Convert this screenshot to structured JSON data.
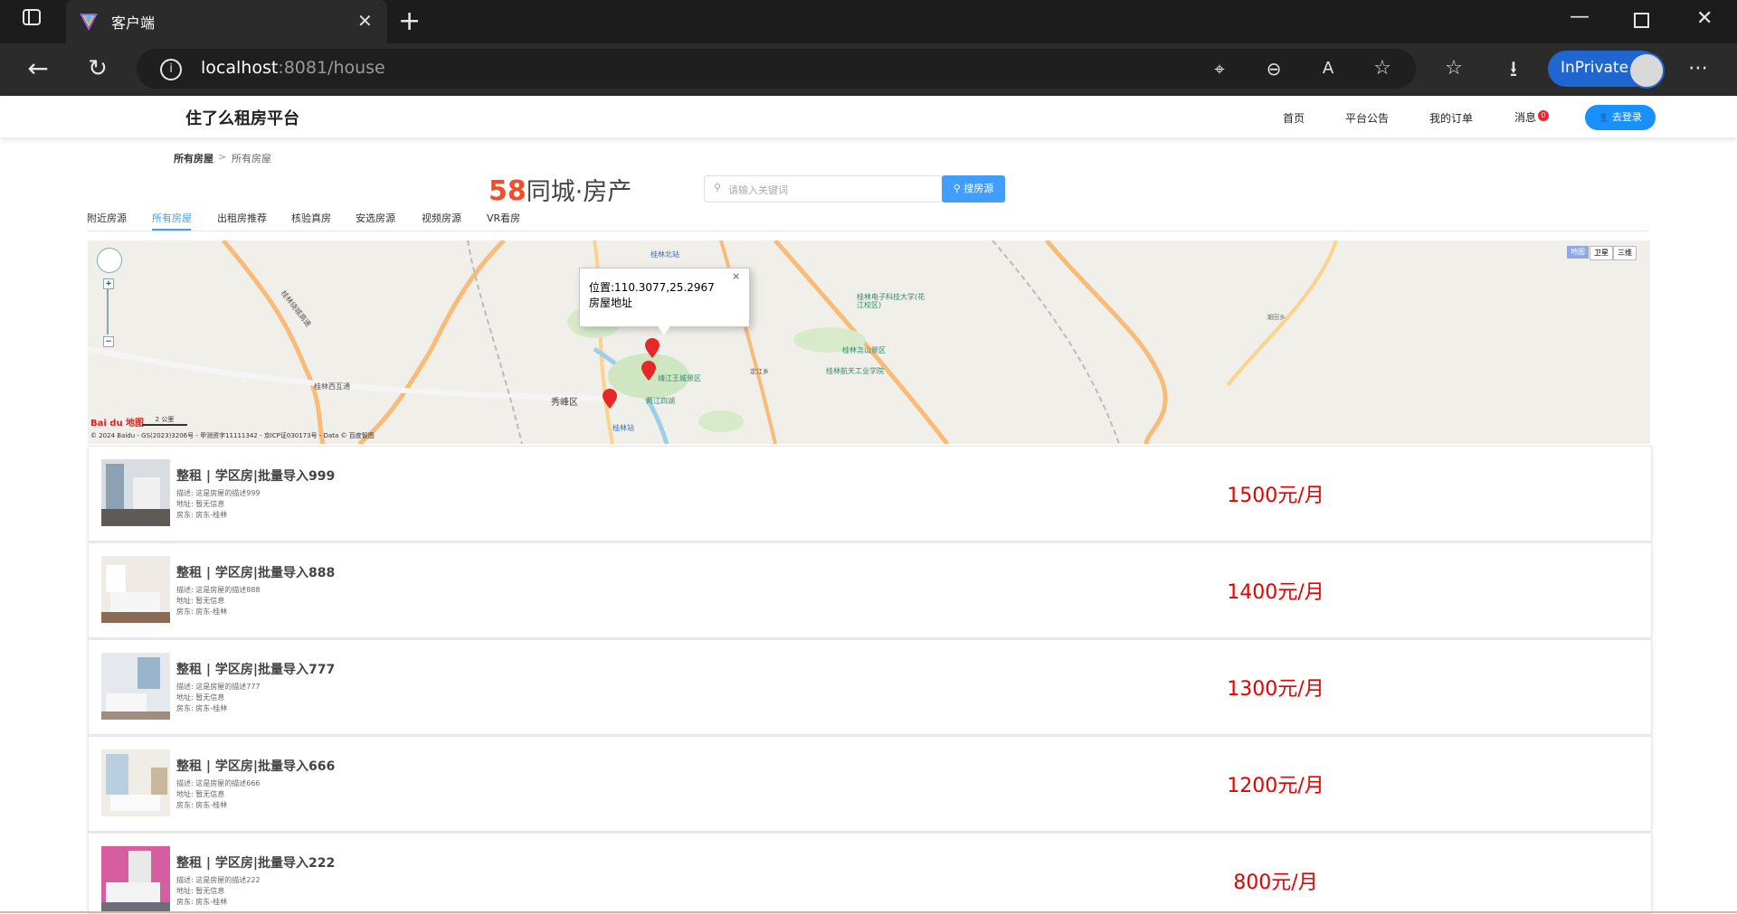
{
  "browser": {
    "tab_title": "客户端",
    "url_host": "localhost",
    "url_rest": ":8081/house",
    "inprivate_label": "InPrivate",
    "icons": [
      "tab-actions-icon",
      "edge-logo-icon",
      "close-tab-icon",
      "new-tab-icon",
      "minimize-icon",
      "restore-icon",
      "close-window-icon",
      "back-icon",
      "refresh-icon",
      "site-info-icon",
      "location-icon",
      "zoom-out-icon",
      "read-aloud-icon",
      "favorite-star-icon",
      "favorites-icon",
      "download-icon",
      "more-icon"
    ]
  },
  "header": {
    "site_title": "住了么租房平台",
    "nav": [
      "首页",
      "平台公告",
      "我的订单",
      "消息"
    ],
    "message_badge": "0",
    "login_label": "去登录"
  },
  "breadcrumb": {
    "home": "所有房屋",
    "separator": ">",
    "current": "所有房屋"
  },
  "brand": {
    "num": "58",
    "name": "同城·房产"
  },
  "search": {
    "placeholder": "请输入关键词",
    "button": "搜房源"
  },
  "tabs": [
    "附近房源",
    "所有房屋",
    "出租房推荐",
    "核验真房",
    "安选房源",
    "视频房源",
    "VR看房"
  ],
  "active_tab_index": 1,
  "map": {
    "modes": [
      "地图",
      "卫星",
      "三维"
    ],
    "info_position": "位置:110.3077,25.2967",
    "info_address": "房屋地址",
    "info_close": "×",
    "scale": "2 公里",
    "copyright": "© 2024 Baidu - GS(2023)3206号 - 甲测资字11111342 - 京ICP证030173号 - Data © 百度智图",
    "logo": "Bai du 地图",
    "labels": {
      "guilin_north": "桂林北站",
      "university": "桂林电子科技大学(花江校区)",
      "yao_mountain": "桂林尧山景区",
      "aerospace": "桂林航天工业学院",
      "xiufeng": "秀峰区",
      "xiufeng_scenic": "靖江王城景区",
      "sihu": "两江四湖",
      "guilin_station": "桂林站",
      "west_hub": "桂林西互通",
      "highway": "桂林绕城高速",
      "east_town": "定江乡",
      "dingjiang": "潮田乡"
    }
  },
  "listings": [
    {
      "title": "整租 | 学区房|批量导入999",
      "desc": "描述: 这是房屋的描述999",
      "addr": "地址: 暂无信息",
      "owner": "房东: 房东-桂林",
      "price": "1500元/月"
    },
    {
      "title": "整租 | 学区房|批量导入888",
      "desc": "描述: 这是房屋的描述888",
      "addr": "地址: 暂无信息",
      "owner": "房东: 房东-桂林",
      "price": "1400元/月"
    },
    {
      "title": "整租 | 学区房|批量导入777",
      "desc": "描述: 这是房屋的描述777",
      "addr": "地址: 暂无信息",
      "owner": "房东: 房东-桂林",
      "price": "1300元/月"
    },
    {
      "title": "整租 | 学区房|批量导入666",
      "desc": "描述: 这是房屋的描述666",
      "addr": "地址: 暂无信息",
      "owner": "房东: 房东-桂林",
      "price": "1200元/月"
    },
    {
      "title": "整租 | 学区房|批量导入222",
      "desc": "描述: 这是房屋的描述222",
      "addr": "地址: 暂无信息",
      "owner": "房东: 房东-桂林",
      "price": "800元/月"
    }
  ]
}
